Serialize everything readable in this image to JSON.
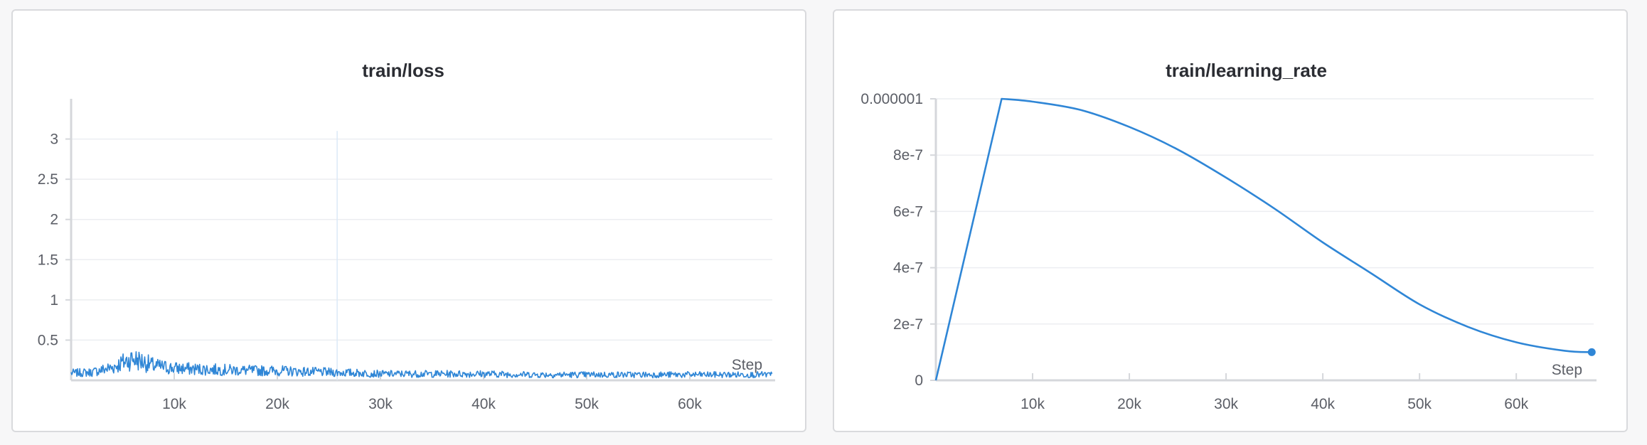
{
  "colors": {
    "series": "#2f86d6",
    "grid": "#eceef1",
    "axis": "#d5d7db",
    "text": "#5b5e66",
    "title": "#2b2d33"
  },
  "chart_data": [
    {
      "type": "line",
      "title": "train/loss",
      "xlabel": "Step",
      "ylabel": "",
      "xlim": [
        0,
        68000
      ],
      "ylim": [
        0,
        3.5
      ],
      "x_ticks": [
        10000,
        20000,
        30000,
        40000,
        50000,
        60000
      ],
      "x_tick_labels": [
        "10k",
        "20k",
        "30k",
        "40k",
        "50k",
        "60k"
      ],
      "y_ticks": [
        0.5,
        1,
        1.5,
        2,
        2.5,
        3
      ],
      "y_tick_labels": [
        "0.5",
        "1",
        "1.5",
        "2",
        "2.5",
        "3"
      ],
      "grid": true,
      "series": [
        {
          "x": [
            0,
            2000,
            4000,
            5000,
            6000,
            7000,
            8000,
            10000,
            12000,
            15000,
            18000,
            20000,
            22000,
            25000,
            28000,
            30000,
            35000,
            40000,
            45000,
            50000,
            55000,
            60000,
            65000,
            68000
          ],
          "y": [
            0.09,
            0.1,
            0.16,
            0.22,
            0.27,
            0.23,
            0.18,
            0.15,
            0.14,
            0.13,
            0.12,
            0.12,
            0.11,
            0.1,
            0.09,
            0.08,
            0.08,
            0.08,
            0.07,
            0.07,
            0.07,
            0.07,
            0.07,
            0.07
          ]
        }
      ]
    },
    {
      "type": "line",
      "title": "train/learning_rate",
      "xlabel": "Step",
      "ylabel": "",
      "xlim": [
        0,
        68000
      ],
      "ylim": [
        0,
        1e-06
      ],
      "x_ticks": [
        10000,
        20000,
        30000,
        40000,
        50000,
        60000
      ],
      "x_tick_labels": [
        "10k",
        "20k",
        "30k",
        "40k",
        "50k",
        "60k"
      ],
      "y_ticks": [
        0,
        2e-07,
        4e-07,
        6e-07,
        8e-07,
        1e-06
      ],
      "y_tick_labels": [
        "0",
        "2e-7",
        "4e-7",
        "6e-7",
        "8e-7",
        "0.000001"
      ],
      "grid": true,
      "series": [
        {
          "x": [
            0,
            6800,
            10000,
            15000,
            20000,
            25000,
            30000,
            35000,
            40000,
            45000,
            50000,
            55000,
            60000,
            65000,
            67800
          ],
          "y": [
            0,
            1e-06,
            9.9e-07,
            9.6e-07,
            9e-07,
            8.2e-07,
            7.2e-07,
            6.1e-07,
            4.9e-07,
            3.8e-07,
            2.7e-07,
            1.9e-07,
            1.35e-07,
            1.05e-07,
            1e-07
          ]
        }
      ]
    }
  ]
}
